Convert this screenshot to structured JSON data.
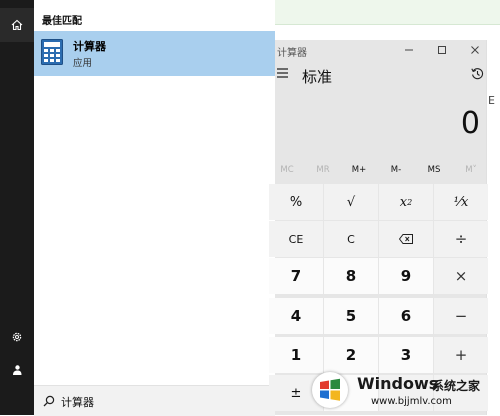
{
  "search_panel": {
    "heading": "最佳匹配",
    "best_match": {
      "name": "计算器",
      "type": "应用"
    },
    "query": "计算器"
  },
  "calculator": {
    "title": "计算器",
    "mode": "标准",
    "display": "0",
    "memory": [
      "MC",
      "MR",
      "M+",
      "M-",
      "MS",
      "M˅"
    ],
    "keys": {
      "percent": "%",
      "sqrt": "√",
      "square_base": "x",
      "square_exp": "2",
      "reciprocal": "¹⁄x",
      "ce": "CE",
      "c": "C",
      "divide": "÷",
      "seven": "7",
      "eight": "8",
      "nine": "9",
      "multiply": "×",
      "four": "4",
      "five": "5",
      "six": "6",
      "minus": "−",
      "one": "1",
      "two": "2",
      "three": "3",
      "plus": "+",
      "negate": "±"
    }
  },
  "background": {
    "partial_text": "E"
  },
  "watermark": {
    "brand": "Windows",
    "suffix": "系统之家",
    "url": "www.bjjmlv.com"
  },
  "colors": {
    "accent": "#a9cfee",
    "rail": "#1b1b1b"
  }
}
